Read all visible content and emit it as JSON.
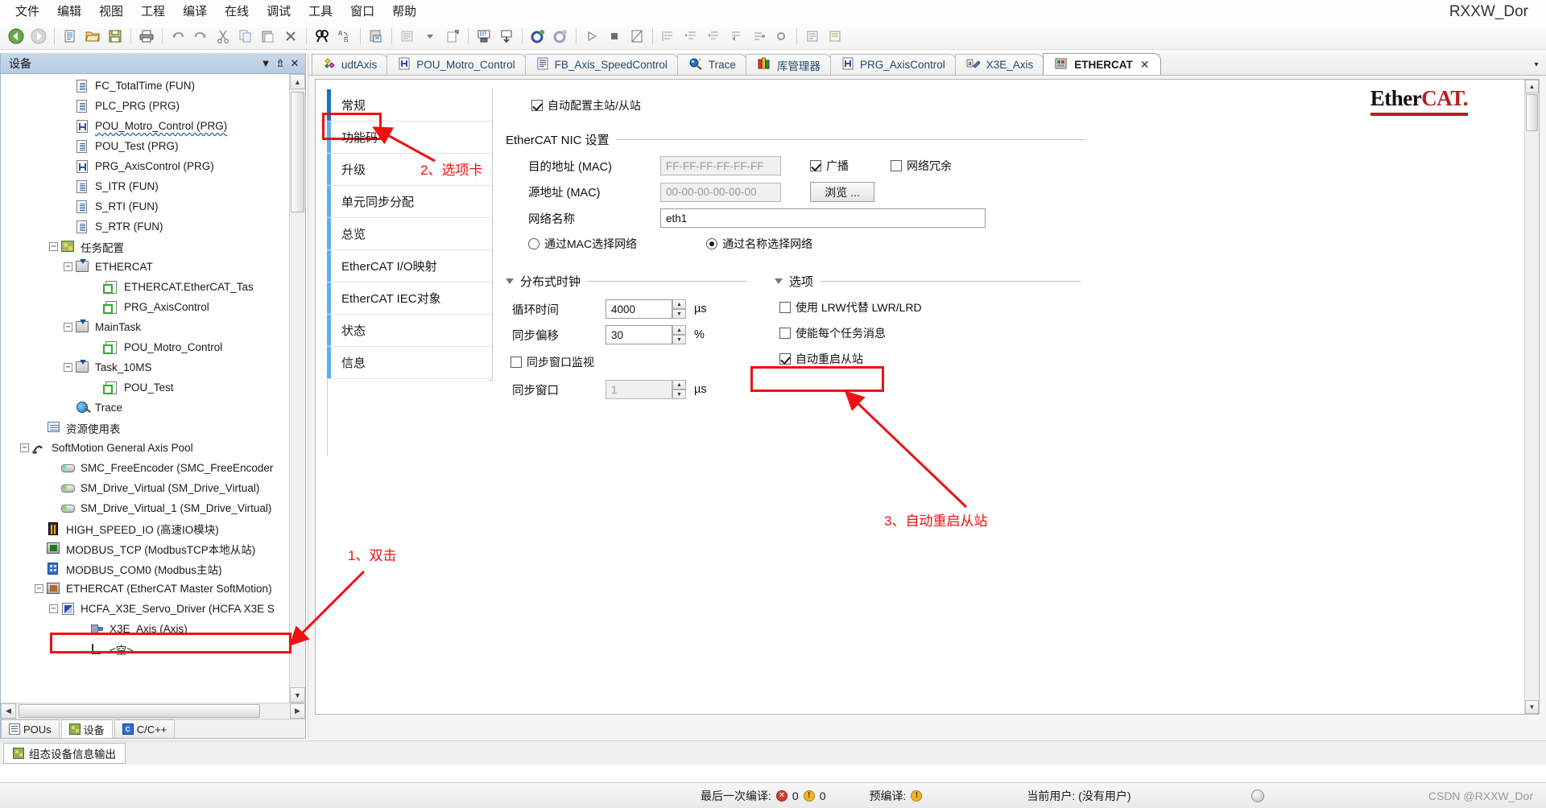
{
  "window": {
    "brand": "RXXW_Dor"
  },
  "menu": {
    "items": [
      "文件",
      "编辑",
      "视图",
      "工程",
      "编译",
      "在线",
      "调试",
      "工具",
      "窗口",
      "帮助"
    ]
  },
  "toolbar": {
    "groups": [
      {
        "buttons": [
          {
            "name": "back-icon",
            "glyph": "◀"
          },
          {
            "name": "forward-icon",
            "glyph": "▶"
          }
        ]
      },
      {
        "buttons": [
          {
            "name": "new-file-icon",
            "glyph": "🗋"
          },
          {
            "name": "open-folder-icon",
            "glyph": "📂"
          },
          {
            "name": "save-icon",
            "glyph": "💾"
          }
        ]
      },
      {
        "buttons": [
          {
            "name": "print-icon",
            "glyph": "🖶"
          }
        ]
      },
      {
        "buttons": [
          {
            "name": "undo-icon",
            "glyph": "↶"
          },
          {
            "name": "redo-icon",
            "glyph": "↷"
          },
          {
            "name": "cut-icon",
            "glyph": "✂"
          },
          {
            "name": "copy-icon",
            "glyph": "⧉"
          },
          {
            "name": "paste-icon",
            "glyph": "📋"
          },
          {
            "name": "delete-icon",
            "glyph": "✕"
          }
        ]
      },
      {
        "buttons": [
          {
            "name": "find-icon",
            "glyph": "🔍"
          },
          {
            "name": "replace-icon",
            "glyph": "⇄"
          }
        ]
      },
      {
        "buttons": [
          {
            "name": "paste-special-icon",
            "glyph": "🗒"
          }
        ]
      },
      {
        "buttons": [
          {
            "name": "build-icon",
            "glyph": "▦"
          },
          {
            "name": "build-dropdown-icon",
            "glyph": "▾"
          },
          {
            "name": "generate-code-icon",
            "glyph": "⬈"
          }
        ]
      },
      {
        "buttons": [
          {
            "name": "login-icon",
            "glyph": "⇲"
          },
          {
            "name": "logout-icon",
            "glyph": "⇱"
          }
        ]
      },
      {
        "buttons": [
          {
            "name": "online-config-icon",
            "glyph": "⚙"
          },
          {
            "name": "online-config-off-icon",
            "glyph": "⚙"
          }
        ]
      },
      {
        "buttons": [
          {
            "name": "run-icon",
            "glyph": "▶"
          },
          {
            "name": "stop-icon",
            "glyph": "■"
          },
          {
            "name": "single-cycle-icon",
            "glyph": "◨"
          }
        ]
      },
      {
        "buttons": [
          {
            "name": "step-over-icon",
            "glyph": "⇥"
          },
          {
            "name": "step-into-icon",
            "glyph": "⇨"
          },
          {
            "name": "step-out-icon",
            "glyph": "⇤"
          },
          {
            "name": "run-to-cursor-icon",
            "glyph": "⇲"
          },
          {
            "name": "set-next-statement-icon",
            "glyph": "⇢"
          },
          {
            "name": "breakpoint-icon",
            "glyph": "●"
          }
        ]
      },
      {
        "buttons": [
          {
            "name": "write-values-icon",
            "glyph": "⌸"
          },
          {
            "name": "force-values-icon",
            "glyph": "⌷"
          }
        ]
      }
    ]
  },
  "device_panel": {
    "title": "设备",
    "header_icons": [
      {
        "name": "dropdown-icon",
        "glyph": "▼"
      },
      {
        "name": "pin-icon",
        "glyph": "⇱"
      },
      {
        "name": "close-icon",
        "glyph": "✕"
      }
    ],
    "tree": [
      {
        "indent": 4,
        "expander": "",
        "icon": "doc",
        "label": "FC_TotalTime (FUN)",
        "squiggle": false,
        "boxed": false
      },
      {
        "indent": 4,
        "expander": "",
        "icon": "doc",
        "label": "PLC_PRG (PRG)",
        "squiggle": false,
        "boxed": false
      },
      {
        "indent": 4,
        "expander": "",
        "icon": "prg",
        "label": "POU_Motro_Control (PRG)",
        "squiggle": true,
        "boxed": false
      },
      {
        "indent": 4,
        "expander": "",
        "icon": "doc",
        "label": "POU_Test (PRG)",
        "squiggle": false,
        "boxed": false
      },
      {
        "indent": 4,
        "expander": "",
        "icon": "prg",
        "label": "PRG_AxisControl (PRG)",
        "squiggle": false,
        "boxed": false
      },
      {
        "indent": 4,
        "expander": "",
        "icon": "doc",
        "label": "S_ITR (FUN)",
        "squiggle": false,
        "boxed": false
      },
      {
        "indent": 4,
        "expander": "",
        "icon": "doc",
        "label": "S_RTI (FUN)",
        "squiggle": false,
        "boxed": false
      },
      {
        "indent": 4,
        "expander": "",
        "icon": "doc",
        "label": "S_RTR (FUN)",
        "squiggle": false,
        "boxed": false
      },
      {
        "indent": 3,
        "expander": "−",
        "icon": "cfg",
        "label": "任务配置",
        "squiggle": false,
        "boxed": false
      },
      {
        "indent": 4,
        "expander": "−",
        "icon": "task",
        "label": "ETHERCAT",
        "squiggle": false,
        "boxed": false
      },
      {
        "indent": 6,
        "expander": "",
        "icon": "link",
        "label": "ETHERCAT.EtherCAT_Tas",
        "squiggle": false,
        "boxed": false
      },
      {
        "indent": 6,
        "expander": "",
        "icon": "link",
        "label": "PRG_AxisControl",
        "squiggle": false,
        "boxed": false
      },
      {
        "indent": 4,
        "expander": "−",
        "icon": "task",
        "label": "MainTask",
        "squiggle": false,
        "boxed": false
      },
      {
        "indent": 6,
        "expander": "",
        "icon": "link",
        "label": "POU_Motro_Control",
        "squiggle": false,
        "boxed": false
      },
      {
        "indent": 4,
        "expander": "−",
        "icon": "task",
        "label": "Task_10MS",
        "squiggle": false,
        "boxed": false
      },
      {
        "indent": 6,
        "expander": "",
        "icon": "link",
        "label": "POU_Test",
        "squiggle": false,
        "boxed": false
      },
      {
        "indent": 4,
        "expander": "",
        "icon": "trace",
        "label": "Trace",
        "squiggle": false,
        "boxed": false
      },
      {
        "indent": 2,
        "expander": "",
        "icon": "grid",
        "label": "资源使用表",
        "squiggle": false,
        "boxed": false
      },
      {
        "indent": 1,
        "expander": "−",
        "icon": "pool",
        "label": "SoftMotion General Axis Pool",
        "squiggle": false,
        "boxed": false
      },
      {
        "indent": 3,
        "expander": "",
        "icon": "axis-c",
        "label": "SMC_FreeEncoder (SMC_FreeEncoder",
        "squiggle": false,
        "boxed": false
      },
      {
        "indent": 3,
        "expander": "",
        "icon": "axis-g",
        "label": "SM_Drive_Virtual (SM_Drive_Virtual)",
        "squiggle": false,
        "boxed": false
      },
      {
        "indent": 3,
        "expander": "",
        "icon": "axis-g",
        "label": "SM_Drive_Virtual_1 (SM_Drive_Virtual)",
        "squiggle": false,
        "boxed": false
      },
      {
        "indent": 2,
        "expander": "",
        "icon": "hs",
        "label": "HIGH_SPEED_IO (高速IO模块)",
        "squiggle": false,
        "boxed": false
      },
      {
        "indent": 2,
        "expander": "",
        "icon": "net",
        "label": "MODBUS_TCP (ModbusTCP本地从站)",
        "squiggle": false,
        "boxed": false
      },
      {
        "indent": 2,
        "expander": "",
        "icon": "blue",
        "label": "MODBUS_COM0 (Modbus主站)",
        "squiggle": false,
        "boxed": false
      },
      {
        "indent": 2,
        "expander": "−",
        "icon": "brn",
        "label": "ETHERCAT (EtherCAT Master SoftMotion)",
        "squiggle": false,
        "boxed": true
      },
      {
        "indent": 3,
        "expander": "−",
        "icon": "drv",
        "label": "HCFA_X3E_Servo_Driver (HCFA X3E S",
        "squiggle": false,
        "boxed": false
      },
      {
        "indent": 5,
        "expander": "",
        "icon": "ax2",
        "label": "X3E_Axis (Axis)",
        "squiggle": false,
        "boxed": false
      },
      {
        "indent": 5,
        "expander": "",
        "icon": "empty",
        "label": "<空>",
        "squiggle": false,
        "boxed": false
      }
    ],
    "bottom_tabs": [
      {
        "label": "POUs",
        "icon": "pou-icon",
        "active": false
      },
      {
        "label": "设备",
        "icon": "device-icon",
        "active": true
      },
      {
        "label": "C/C++",
        "icon": "cpp-icon",
        "active": false
      }
    ]
  },
  "editor": {
    "tabs": [
      {
        "label": "udtAxis",
        "icon": "datatype-icon",
        "active": false,
        "closable": false
      },
      {
        "label": "POU_Motro_Control",
        "icon": "prg-icon",
        "active": false,
        "closable": false
      },
      {
        "label": "FB_Axis_SpeedControl",
        "icon": "doc-icon",
        "active": false,
        "closable": false
      },
      {
        "label": "Trace",
        "icon": "trace-icon",
        "active": false,
        "closable": false
      },
      {
        "label": "库管理器",
        "icon": "library-icon",
        "active": false,
        "closable": false
      },
      {
        "label": "PRG_AxisControl",
        "icon": "prg-icon",
        "active": false,
        "closable": false
      },
      {
        "label": "X3E_Axis",
        "icon": "axis-icon",
        "active": false,
        "closable": false
      },
      {
        "label": "ETHERCAT",
        "icon": "ethercat-icon",
        "active": true,
        "closable": true
      }
    ],
    "tab_overflow_icon": "chevron-down-icon"
  },
  "config_page": {
    "categories": [
      {
        "label": "常规",
        "active": true
      },
      {
        "label": "功能码",
        "active": false
      },
      {
        "label": "升级",
        "active": false
      },
      {
        "label": "单元同步分配",
        "active": false
      },
      {
        "label": "总览",
        "active": false
      },
      {
        "label": "EtherCAT I/O映射",
        "active": false
      },
      {
        "label": "EtherCAT IEC对象",
        "active": false
      },
      {
        "label": "状态",
        "active": false
      },
      {
        "label": "信息",
        "active": false
      }
    ],
    "autoconfig": {
      "label": "自动配置主站/从站",
      "checked": true
    },
    "logo": {
      "text_left": "Ether",
      "text_right": "CAT",
      "dot": "."
    },
    "nic": {
      "group_label": "EtherCAT NIC 设置",
      "dest_mac_label": "目的地址 (MAC)",
      "dest_mac_value": "FF-FF-FF-FF-FF-FF",
      "src_mac_label": "源地址 (MAC)",
      "src_mac_value": "00-00-00-00-00-00",
      "netname_label": "网络名称",
      "netname_value": "eth1",
      "broadcast_label": "广播",
      "broadcast_checked": true,
      "redundancy_label": "网络冗余",
      "redundancy_checked": false,
      "browse_label": "浏览 ...",
      "select_by_mac_label": "通过MAC选择网络",
      "select_by_mac_checked": false,
      "select_by_name_label": "通过名称选择网络",
      "select_by_name_checked": true
    },
    "dc": {
      "group_label": "分布式时钟",
      "cycletime_label": "循环时间",
      "cycletime_value": "4000",
      "cycletime_unit": "µs",
      "syncoffset_label": "同步偏移",
      "syncoffset_value": "30",
      "syncoffset_unit": "%",
      "syncwindow_monitor_label": "同步窗口监视",
      "syncwindow_monitor_checked": false,
      "syncwindow_label": "同步窗口",
      "syncwindow_value": "1",
      "syncwindow_unit": "µs"
    },
    "options": {
      "group_label": "选项",
      "items": [
        {
          "label": "使用 LRW代替 LWR/LRD",
          "checked": false,
          "highlight": false
        },
        {
          "label": "使能每个任务消息",
          "checked": false,
          "highlight": false
        },
        {
          "label": "自动重启从站",
          "checked": true,
          "highlight": true
        }
      ]
    }
  },
  "annotations": [
    {
      "name": "annotation-double-click",
      "text": "1、双击",
      "color": "#ee1111"
    },
    {
      "name": "annotation-tab",
      "text": "2、选项卡",
      "color": "#ee1111"
    },
    {
      "name": "annotation-auto-restart",
      "text": "3、自动重启从站",
      "color": "#ee1111"
    }
  ],
  "output_panel": {
    "tabs": [
      {
        "label": "组态设备信息输出",
        "icon": "output-icon"
      }
    ]
  },
  "status_bar": {
    "last_build_label": "最后一次编译:",
    "errors_count": "0",
    "warnings_count": "0",
    "precompile_label": "预编译:",
    "current_user_label": "当前用户: (没有用户)",
    "watermark": "CSDN @RXXW_Dor"
  }
}
